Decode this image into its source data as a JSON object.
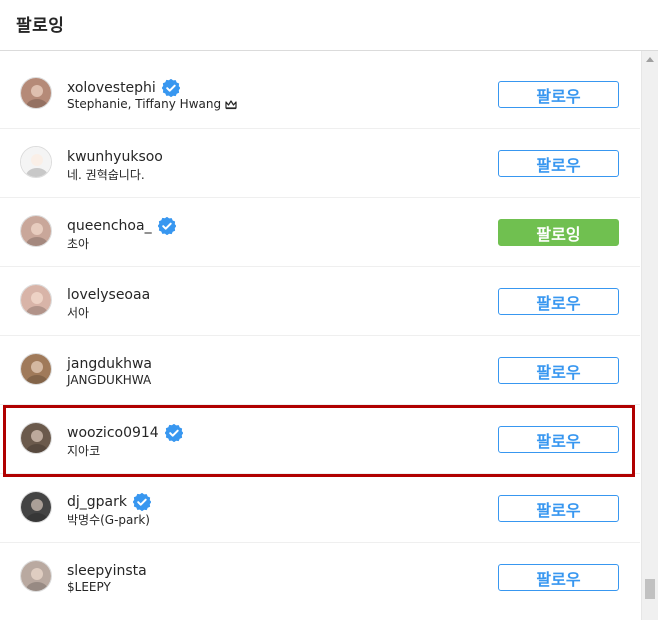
{
  "header": {
    "title": "팔로잉"
  },
  "users": [
    {
      "username": "xolovestephi",
      "fullname": "Stephanie, Tiffany Hwang",
      "verified": true,
      "crown": true,
      "button": "팔로우",
      "following": false,
      "avatar_color": "#b58a78"
    },
    {
      "username": "kwunhyuksoo",
      "fullname": "네. 권혁숩니다.",
      "verified": false,
      "crown": false,
      "button": "팔로우",
      "following": false,
      "avatar_color": "#f4f4f4"
    },
    {
      "username": "queenchoa_",
      "fullname": "초아",
      "verified": true,
      "crown": false,
      "button": "팔로잉",
      "following": true,
      "avatar_color": "#c9a79a"
    },
    {
      "username": "lovelyseoaa",
      "fullname": "서아",
      "verified": false,
      "crown": false,
      "button": "팔로우",
      "following": false,
      "avatar_color": "#d8b4a8"
    },
    {
      "username": "jangdukhwa",
      "fullname": "JANGDUKHWA",
      "verified": false,
      "crown": false,
      "button": "팔로우",
      "following": false,
      "avatar_color": "#a07a5a"
    },
    {
      "username": "woozico0914",
      "fullname": "지아코",
      "verified": true,
      "crown": false,
      "button": "팔로우",
      "following": false,
      "avatar_color": "#6b5a4c"
    },
    {
      "username": "dj_gpark",
      "fullname": "박명수(G-park)",
      "verified": true,
      "crown": false,
      "button": "팔로우",
      "following": false,
      "avatar_color": "#444444"
    },
    {
      "username": "sleepyinsta",
      "fullname": "$LEEPY",
      "verified": false,
      "crown": false,
      "button": "팔로우",
      "following": false,
      "avatar_color": "#b9a9a0"
    }
  ],
  "colors": {
    "accent": "#3897f0",
    "following_bg": "#70c050",
    "highlight": "#b00000"
  }
}
